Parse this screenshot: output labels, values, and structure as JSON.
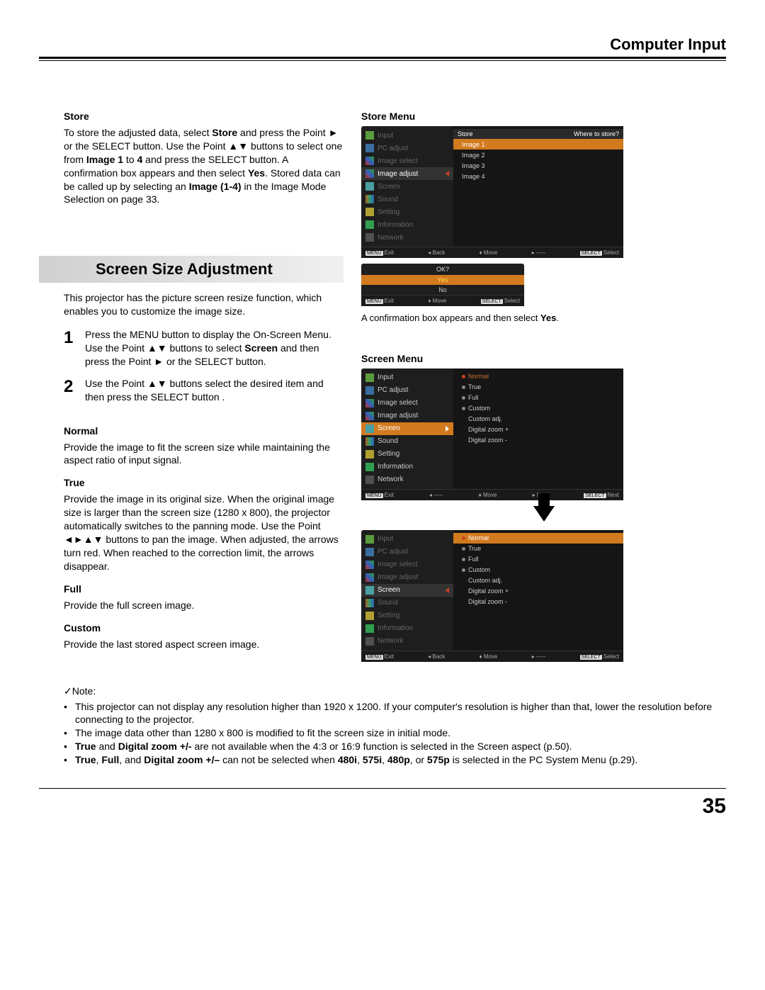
{
  "header": {
    "title": "Computer Input"
  },
  "store": {
    "heading": "Store",
    "text": "To store the adjusted data, select Store and press the Point ► or the SELECT button. Use the Point ▲▼ buttons to select one from Image 1 to 4 and press the SELECT button. A confirmation box appears and then select Yes. Stored data can be called up by selecting an Image (1-4) in the Image Mode Selection on page 33."
  },
  "section": {
    "title": "Screen Size Adjustment"
  },
  "intro": "This projector has the picture screen resize function, which enables you to customize the image size.",
  "steps": [
    {
      "num": "1",
      "text": "Press the MENU button to display the On-Screen Menu. Use the Point ▲▼ buttons to select Screen and then press the Point ► or the SELECT button."
    },
    {
      "num": "2",
      "text": "Use the Point ▲▼ buttons select the desired item and then press the SELECT button ."
    }
  ],
  "modes": [
    {
      "name": "Normal",
      "desc": "Provide the image to fit the screen size while maintaining the aspect ratio of input signal."
    },
    {
      "name": "True",
      "desc": "Provide the image in its original size. When the original image size is larger than the screen size (1280 x 800), the projector automatically switches to the panning mode. Use the Point ◄►▲▼ buttons to pan the image. When adjusted, the arrows turn red. When reached to the correction limit, the arrows disappear."
    },
    {
      "name": "Full",
      "desc": "Provide the full screen image."
    },
    {
      "name": "Custom",
      "desc": "Provide the last stored aspect screen image."
    }
  ],
  "right": {
    "storeMenu": {
      "title": "Store Menu",
      "header": {
        "left": "Store",
        "right": "Where to store?"
      },
      "side": [
        "Input",
        "PC adjust",
        "Image select",
        "Image adjust",
        "Screen",
        "Sound",
        "Setting",
        "Information",
        "Network"
      ],
      "selectedSide": "Image adjust",
      "items": [
        "Image 1",
        "Image 2",
        "Image 3",
        "Image 4"
      ],
      "footer": {
        "exit": "Exit",
        "back": "Back",
        "move": "Move",
        "blank": "-----",
        "select": "Select"
      }
    },
    "confirm": {
      "head": "OK?",
      "yes": "Yes",
      "no": "No",
      "caption": "A confirmation box appears and then select Yes.",
      "footer": {
        "exit": "Exit",
        "move": "Move",
        "select": "Select"
      }
    },
    "screenMenu": {
      "title": "Screen Menu",
      "side": [
        "Input",
        "PC adjust",
        "Image select",
        "Image adjust",
        "Screen",
        "Sound",
        "Setting",
        "Information",
        "Network"
      ],
      "selectedSide": "Screen",
      "items": [
        "Normal",
        "True",
        "Full",
        "Custom",
        "Custom adj.",
        "Digital zoom +",
        "Digital zoom -"
      ],
      "footerA": {
        "exit": "Exit",
        "blank": "-----",
        "move": "Move",
        "next": "Next",
        "nextR": "Next"
      },
      "footerB": {
        "exit": "Exit",
        "back": "Back",
        "move": "Move",
        "blank": "-----",
        "select": "Select"
      }
    }
  },
  "notes": {
    "head": "Note:",
    "items": [
      "This projector can not display any resolution higher than 1920 x 1200. If your computer's resolution is higher than that, lower the resolution before connecting to the projector.",
      "The image data other than 1280 x 800 is modified to fit the screen size in initial mode.",
      "True and Digital zoom +/- are not available when the 4:3 or 16:9 function is selected in the Screen aspect (p.50).",
      "True, Full, and Digital zoom +/– can not be selected when 480i, 575i, 480p, or 575p is selected in the PC System Menu (p.29)."
    ]
  },
  "pageNumber": "35"
}
